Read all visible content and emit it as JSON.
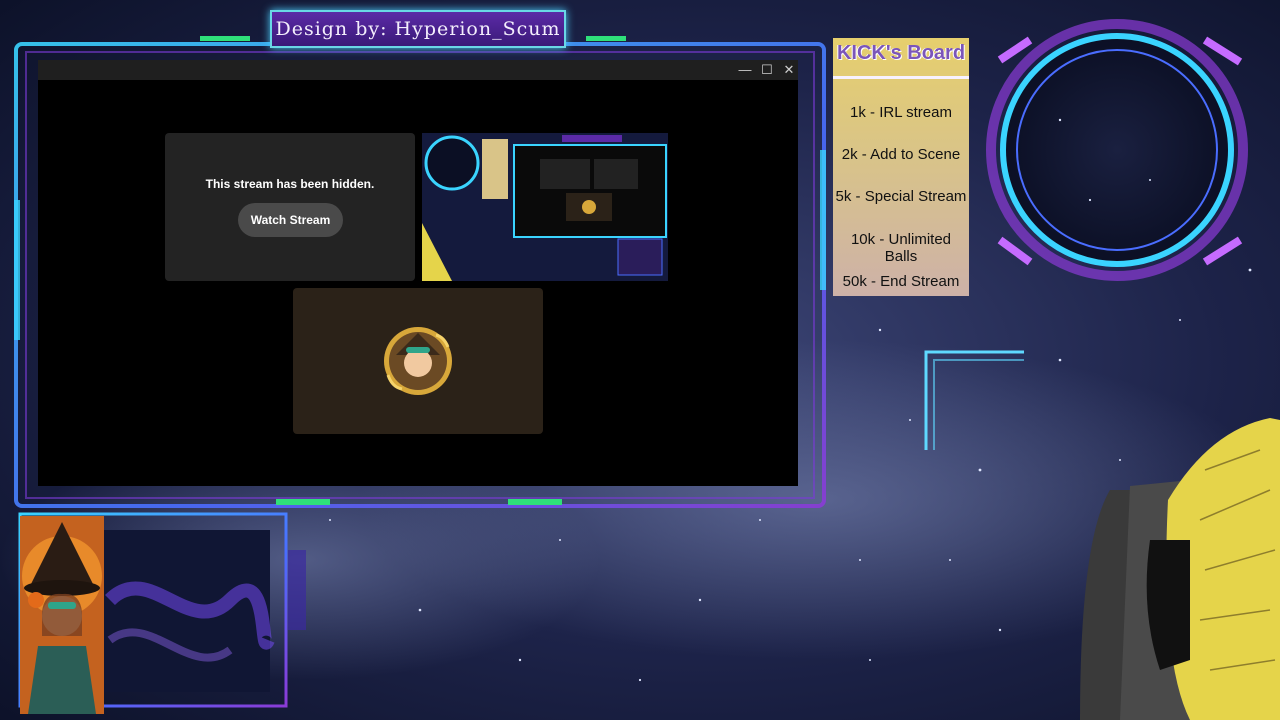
{
  "banner": {
    "text": "Design by: Hyperion_Scum"
  },
  "window": {
    "controls": {
      "minimize": "—",
      "maximize": "☐",
      "close": "✕"
    }
  },
  "stream_tile": {
    "message": "This stream has been hidden.",
    "button": "Watch Stream"
  },
  "board": {
    "title": "KICK's Board",
    "items": [
      {
        "label": "1k - IRL stream"
      },
      {
        "label": "2k - Add to Scene"
      },
      {
        "label": "5k - Special Stream"
      },
      {
        "label": "10k - Unlimited Balls"
      },
      {
        "label": "50k - End Stream"
      }
    ]
  },
  "colors": {
    "frame_cyan": "#3ad4ff",
    "frame_purple": "#7a3bd6",
    "frame_green": "#2fe07a",
    "board_title": "#7b55b9",
    "window_bg": "#000000"
  }
}
